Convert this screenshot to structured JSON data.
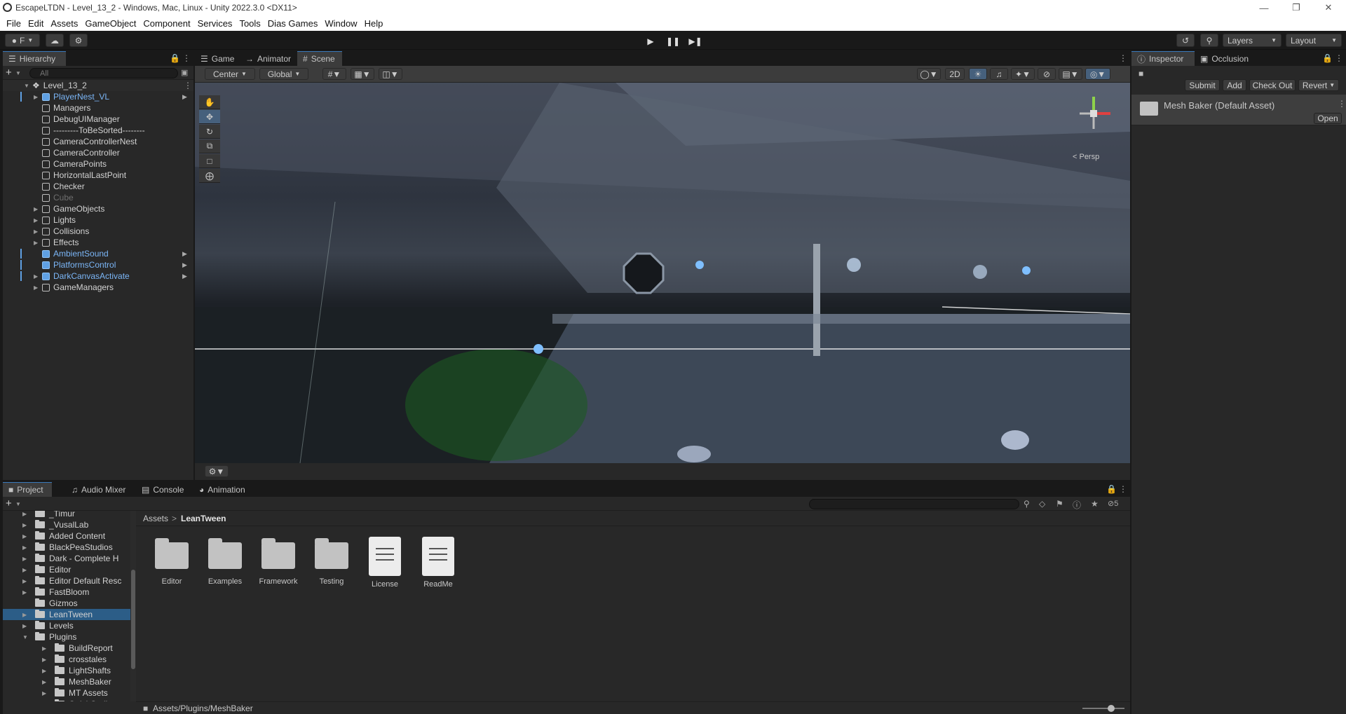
{
  "window": {
    "title": "EscapeLTDN - Level_13_2 - Windows, Mac, Linux - Unity 2022.3.0 <DX11>"
  },
  "menu": [
    "File",
    "Edit",
    "Assets",
    "GameObject",
    "Component",
    "Services",
    "Tools",
    "Dias Games",
    "Window",
    "Help"
  ],
  "toolbar": {
    "account_label": "F",
    "layers_label": "Layers",
    "layout_label": "Layout"
  },
  "hierarchy": {
    "tab_label": "Hierarchy",
    "search_placeholder": "All",
    "scene_name": "Level_13_2",
    "items": [
      {
        "label": "PlayerNest_VL",
        "prefab": true,
        "expandable": true
      },
      {
        "label": "Managers",
        "prefab": false,
        "expandable": false
      },
      {
        "label": "DebugUIManager",
        "prefab": false,
        "expandable": false
      },
      {
        "label": "---------ToBeSorted--------",
        "prefab": false,
        "expandable": false
      },
      {
        "label": "CameraControllerNest",
        "prefab": false,
        "expandable": false
      },
      {
        "label": "CameraController",
        "prefab": false,
        "expandable": false
      },
      {
        "label": "CameraPoints",
        "prefab": false,
        "expandable": false
      },
      {
        "label": "HorizontalLastPoint",
        "prefab": false,
        "expandable": false
      },
      {
        "label": "Checker",
        "prefab": false,
        "expandable": false
      },
      {
        "label": "Cube",
        "prefab": false,
        "expandable": false,
        "disabled": true
      },
      {
        "label": "GameObjects",
        "prefab": false,
        "expandable": true
      },
      {
        "label": "Lights",
        "prefab": false,
        "expandable": true
      },
      {
        "label": "Collisions",
        "prefab": false,
        "expandable": true
      },
      {
        "label": "Effects",
        "prefab": false,
        "expandable": true
      },
      {
        "label": "AmbientSound",
        "prefab": true,
        "expandable": false
      },
      {
        "label": "PlatformsControl",
        "prefab": true,
        "expandable": false
      },
      {
        "label": "DarkCanvasActivate",
        "prefab": true,
        "expandable": true
      },
      {
        "label": "GameManagers",
        "prefab": false,
        "expandable": true
      }
    ]
  },
  "scene_tabs": [
    "Game",
    "Animator",
    "Scene"
  ],
  "scene_toolbar": {
    "pivot": "Center",
    "space": "Global",
    "mode2d": "2D",
    "persp": "< Persp"
  },
  "inspector": {
    "tabs": [
      "Inspector",
      "Occlusion"
    ],
    "buttons": [
      "Submit",
      "Add",
      "Check Out",
      "Revert"
    ],
    "asset_title": "Mesh Baker (Default Asset)",
    "open_label": "Open"
  },
  "bottom_tabs": [
    "Project",
    "Audio Mixer",
    "Console",
    "Animation"
  ],
  "project": {
    "tree": [
      {
        "label": "_Timur",
        "indent": 1,
        "expandable": true
      },
      {
        "label": "_VusalLab",
        "indent": 1,
        "expandable": true
      },
      {
        "label": "Added Content",
        "indent": 1,
        "expandable": true
      },
      {
        "label": "BlackPeaStudios",
        "indent": 1,
        "expandable": true
      },
      {
        "label": "Dark - Complete H",
        "indent": 1,
        "expandable": true
      },
      {
        "label": "Editor",
        "indent": 1,
        "expandable": true
      },
      {
        "label": "Editor Default Resc",
        "indent": 1,
        "expandable": true
      },
      {
        "label": "FastBloom",
        "indent": 1,
        "expandable": true
      },
      {
        "label": "Gizmos",
        "indent": 1,
        "expandable": false
      },
      {
        "label": "LeanTween",
        "indent": 1,
        "expandable": true,
        "selected": true
      },
      {
        "label": "Levels",
        "indent": 1,
        "expandable": true
      },
      {
        "label": "Plugins",
        "indent": 1,
        "expandable": true,
        "open": true
      },
      {
        "label": "BuildReport",
        "indent": 2,
        "expandable": true
      },
      {
        "label": "crosstales",
        "indent": 2,
        "expandable": true
      },
      {
        "label": "LightShafts",
        "indent": 2,
        "expandable": true
      },
      {
        "label": "MeshBaker",
        "indent": 2,
        "expandable": true
      },
      {
        "label": "MT Assets",
        "indent": 2,
        "expandable": true
      },
      {
        "label": "QuickOutline",
        "indent": 2,
        "expandable": true
      }
    ],
    "breadcrumb": [
      "Assets",
      "LeanTween"
    ],
    "assets": [
      {
        "label": "Editor",
        "kind": "folder"
      },
      {
        "label": "Examples",
        "kind": "folder"
      },
      {
        "label": "Framework",
        "kind": "folder"
      },
      {
        "label": "Testing",
        "kind": "folder"
      },
      {
        "label": "License",
        "kind": "doc"
      },
      {
        "label": "ReadMe",
        "kind": "doc"
      }
    ],
    "hidden_count": "5",
    "status_path": "Assets/Plugins/MeshBaker"
  }
}
